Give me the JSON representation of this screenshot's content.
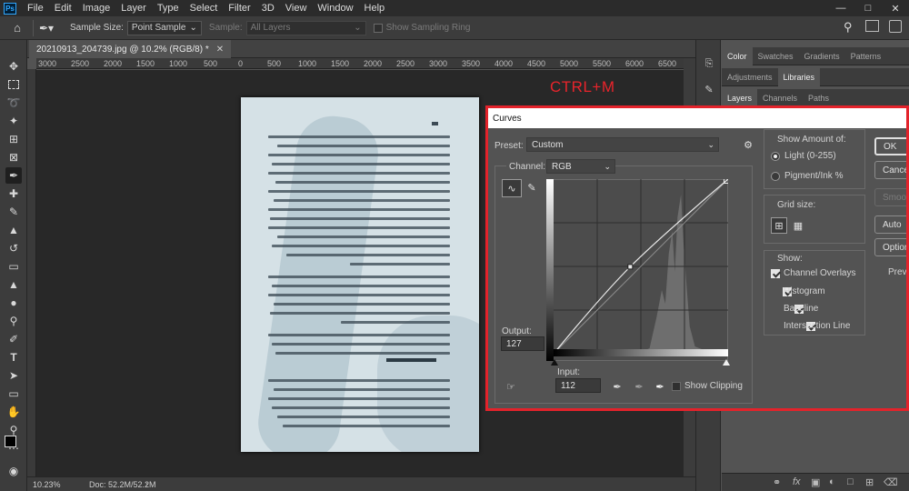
{
  "menubar": {
    "app_icon": "ps-logo",
    "app_label": "Ps",
    "items": [
      "File",
      "Edit",
      "Image",
      "Layer",
      "Type",
      "Select",
      "Filter",
      "3D",
      "View",
      "Window",
      "Help"
    ],
    "window_controls": [
      "minimize-icon",
      "maximize-icon",
      "close-icon"
    ]
  },
  "options_bar": {
    "sample_size_label": "Sample Size:",
    "sample_size_value": "Point Sample",
    "sample_label": "Sample:",
    "sample_value": "All Layers",
    "show_ring_label": "Show Sampling Ring"
  },
  "document": {
    "tab_title": "20210913_204739.jpg @ 10.2% (RGB/8) *",
    "ruler_ticks": [
      "3000",
      "2500",
      "2000",
      "1500",
      "1000",
      "500",
      "0",
      "500",
      "1000",
      "1500",
      "2000",
      "2500",
      "3000",
      "3500",
      "4000",
      "4500",
      "5000",
      "5500",
      "6000",
      "6500"
    ],
    "zoom": "10.23%",
    "doc_size": "Doc: 52.2M/52.2M"
  },
  "annotation": {
    "shortcut": "CTRL+M",
    "highlight_color": "#e3232b"
  },
  "panels": {
    "top_tabs": [
      "Color",
      "Swatches",
      "Gradients",
      "Patterns"
    ],
    "mid_tabs": [
      "Adjustments",
      "Libraries"
    ],
    "layer_tabs": [
      "Layers",
      "Channels",
      "Paths"
    ]
  },
  "curves_dialog": {
    "title": "Curves",
    "preset_label": "Preset:",
    "preset_value": "Custom",
    "channel_label": "Channel:",
    "channel_value": "RGB",
    "output_label": "Output:",
    "output_value": "127",
    "input_label": "Input:",
    "input_value": "112",
    "show_clipping_label": "Show Clipping",
    "show_amount_label": "Show Amount of:",
    "light_label": "Light  (0-255)",
    "pigment_label": "Pigment/Ink %",
    "grid_size_label": "Grid size:",
    "show_label": "Show:",
    "show_options": [
      "Channel Overlays",
      "Histogram",
      "Baseline",
      "Intersection Line"
    ],
    "buttons": {
      "ok": "OK",
      "cancel": "Cancel",
      "smooth": "Smooth",
      "auto": "Auto",
      "options": "Options...",
      "preview": "Preview"
    },
    "curve_point": {
      "input": 112,
      "output": 127
    }
  }
}
